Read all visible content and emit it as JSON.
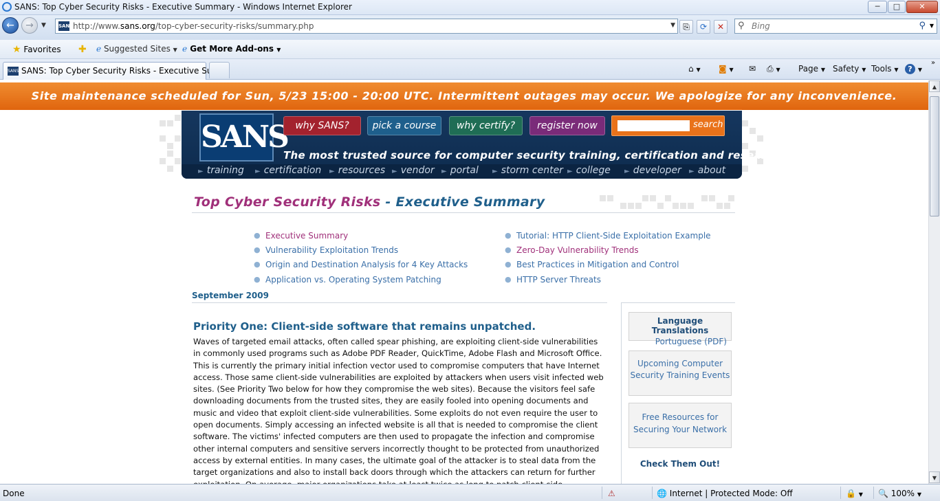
{
  "window": {
    "title": "SANS: Top Cyber Security Risks - Executive Summary - Windows Internet Explorer",
    "minimize": "─",
    "maximize": "□",
    "close": "✕"
  },
  "address_bar": {
    "url_prefix": "http://www.",
    "url_domain": "sans.org",
    "url_path": "/top-cyber-security-risks/summary.php",
    "search_placeholder": "Bing",
    "compat_icon": "compatibility-view-icon",
    "refresh_icon": "refresh-icon",
    "stop_icon": "stop-icon"
  },
  "favorites_bar": {
    "favorites": "Favorites",
    "suggested_sites": "Suggested Sites",
    "get_more_addons": "Get More Add-ons"
  },
  "tabs": {
    "active_title": "SANS: Top Cyber Security Risks - Executive Sum..."
  },
  "command_bar": {
    "page": "Page",
    "safety": "Safety",
    "tools": "Tools",
    "help": "?"
  },
  "page": {
    "banner": "Site maintenance scheduled for Sun, 5/23 15:00 - 20:00 UTC. Intermittent outages may occur. We apologize for any inconvenience.",
    "logo": "SANS",
    "header_buttons": [
      "why SANS?",
      "pick a course",
      "why certify?",
      "register now"
    ],
    "search_label": "search",
    "tagline": "The most trusted source for computer security training, certification and research.",
    "nav": [
      "training",
      "certification",
      "resources",
      "vendor",
      "portal",
      "storm center",
      "college",
      "developer",
      "about"
    ],
    "title_part1": "Top Cyber Security Risks",
    "title_sep": " - ",
    "title_part2": "Executive Summary",
    "toc_left": [
      "Executive Summary",
      "Vulnerability Exploitation Trends",
      "Origin and Destination Analysis for 4 Key Attacks",
      "Application vs. Operating System Patching"
    ],
    "toc_right": [
      "Tutorial: HTTP Client-Side Exploitation Example",
      "Zero-Day Vulnerability Trends",
      "Best Practices in Mitigation and Control",
      "HTTP Server Threats"
    ],
    "date": "September 2009",
    "section_heading": "Priority One: Client-side software that remains unpatched.",
    "body": "Waves of targeted email attacks, often called spear phishing, are exploiting client-side vulnerabilities in commonly used programs such as Adobe PDF Reader, QuickTime, Adobe Flash and Microsoft Office. This is currently the primary initial infection vector used to compromise computers that have Internet access. Those same client-side vulnerabilities are exploited by attackers when users visit infected web sites. (See Priority Two below for how they compromise the web sites). Because the visitors feel safe downloading documents from the trusted sites, they are easily fooled into opening documents and music and video that exploit client-side vulnerabilities. Some exploits do not even require the user to open documents. Simply accessing an infected website is all that is needed to compromise the client software. The victims' infected computers are then used to propagate the infection and compromise other internal computers and sensitive servers incorrectly thought to be protected from unauthorized access by external entities. In many cases, the ultimate goal of the attacker is to steal data from the target organizations and also to install back doors through which the attackers can return for further exploitation. On average, major organizations take at least twice as long to patch client-side vulnerabilities as they take to patch",
    "sidebar": {
      "lang_heading": "Language Translations",
      "lang_link": "Portuguese (PDF)",
      "box2_line1": "Upcoming Computer",
      "box2_line2": "Security Training Events",
      "box3_line1": "Free Resources for",
      "box3_line2": "Securing Your Network",
      "check_out": "Check Them Out!"
    }
  },
  "status_bar": {
    "status": "Done",
    "zone": "Internet | Protected Mode: Off",
    "zoom": "100%"
  },
  "colors": {
    "banner": "#e87420",
    "header_navy": "#16375f",
    "title_magenta": "#a0307a",
    "title_blue": "#1f5f8b",
    "link_blue": "#3a6fa8",
    "btn_red": "#a3222e",
    "btn_blue": "#1e5f8c",
    "btn_green": "#1f6d55",
    "btn_purple": "#7a2b79",
    "search_orange": "#e9721a"
  }
}
